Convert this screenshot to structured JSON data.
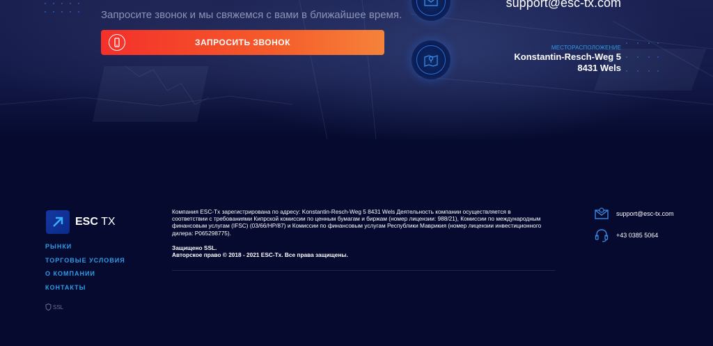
{
  "hero": {
    "subtitle": "Запросите звонок и мы свяжемся с вами в ближайшее время.",
    "call_button_label": "ЗАПРОСИТЬ ЗВОНОК",
    "email": "support@esc-tx.com",
    "location_label": "МЕСТОРАСПОЛОЖЕНИЕ",
    "address_line1": "Konstantin-Resch-Weg 5",
    "address_line2": "8431 Wels"
  },
  "footer": {
    "logo_bold": "ESC",
    "logo_regular": " TX",
    "nav": [
      "РЫНКИ",
      "ТОРГОВЫЕ УСЛОВИЯ",
      "О КОМПАНИИ",
      "КОНТАКТЫ"
    ],
    "ssl": "SSL",
    "legal_text": "Компания ESC-Tx зарегистрирована по адресу: Konstantin-Resch-Weg 5 8431 Wels Деятельность компании осуществляется в соответствии с требованиями Кипрской комиссии по ценным бумагам и биржам (номер лицензии: 988/21), Комиссии по международным финансовым услугам (IFSC) (03/66/HP/87) и Комиссии по финансовым услугам Республики Маврикия (номер лицензии инвестиционного дилера: P065298775).",
    "protected": "Защищено SSL.",
    "copyright": "Авторское право © 2018 - 2021 ESC-Tx. Все права защищены.",
    "contact_email": "support@esc-tx.com",
    "contact_phone": "+43 0385 5064"
  },
  "colors": {
    "background": "#050a2e",
    "accent_blue": "#2f9ce8",
    "button_gradient_start": "#f4302a",
    "button_gradient_end": "#f5823a"
  },
  "icons": [
    "phone-icon",
    "mail-icon",
    "map-pin-icon",
    "arrow-up-right-icon",
    "shield-icon",
    "headset-icon"
  ]
}
